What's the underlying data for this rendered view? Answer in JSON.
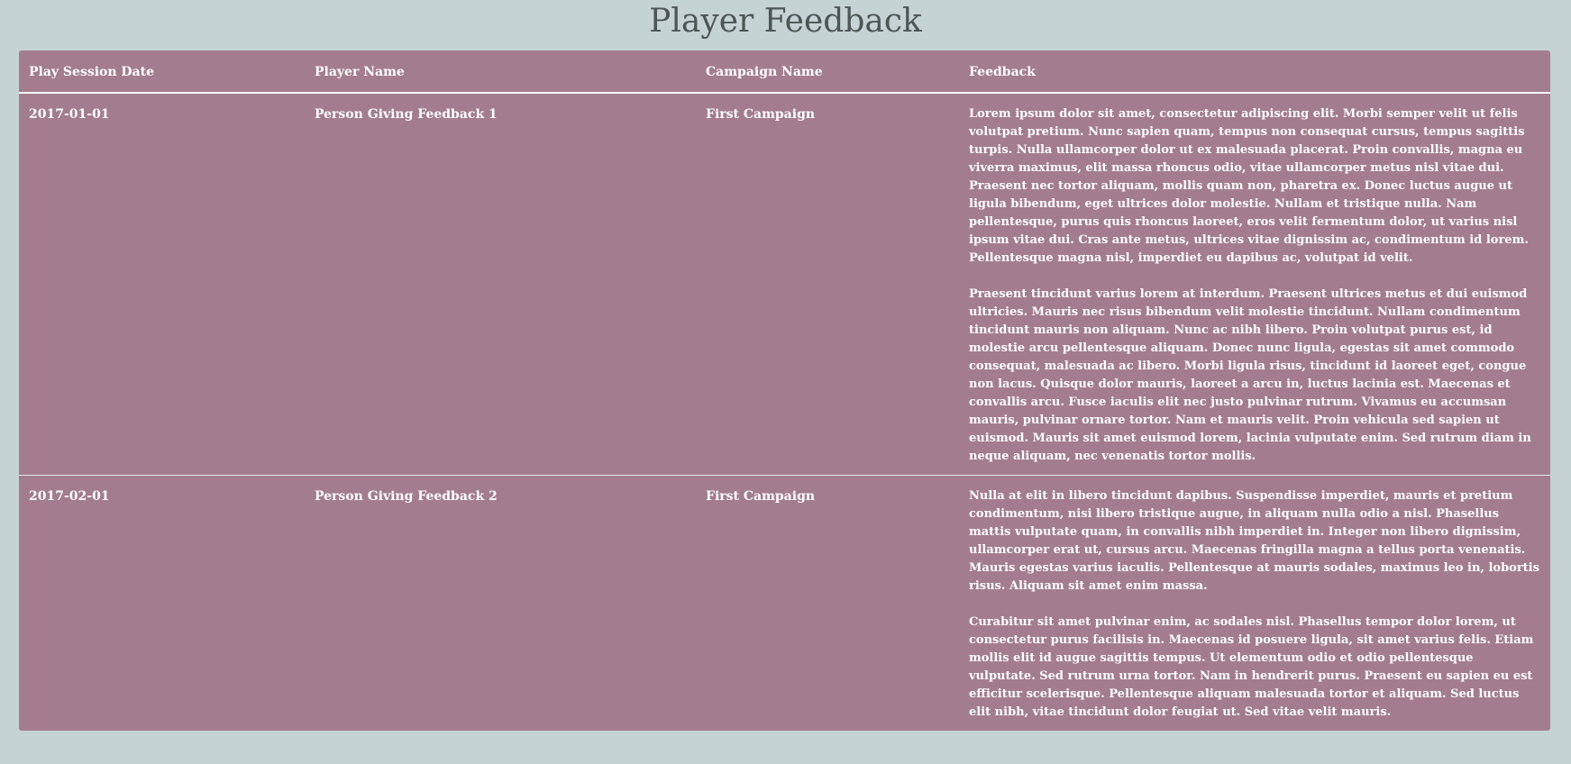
{
  "page": {
    "title": "Player Feedback"
  },
  "table": {
    "headers": [
      "Play Session Date",
      "Player Name",
      "Campaign Name",
      "Feedback"
    ],
    "rows": [
      {
        "date": "2017-01-01",
        "player": "Person Giving Feedback 1",
        "campaign": "First Campaign",
        "feedback": [
          "Lorem ipsum dolor sit amet, consectetur adipiscing elit. Morbi semper velit ut felis volutpat pretium. Nunc sapien quam, tempus non consequat cursus, tempus sagittis turpis. Nulla ullamcorper dolor ut ex malesuada placerat. Proin convallis, magna eu viverra maximus, elit massa rhoncus odio, vitae ullamcorper metus nisl vitae dui. Praesent nec tortor aliquam, mollis quam non, pharetra ex. Donec luctus augue ut ligula bibendum, eget ultrices dolor molestie. Nullam et tristique nulla. Nam pellentesque, purus quis rhoncus laoreet, eros velit fermentum dolor, ut varius nisl ipsum vitae dui. Cras ante metus, ultrices vitae dignissim ac, condimentum id lorem. Pellentesque magna nisl, imperdiet eu dapibus ac, volutpat id velit.",
          "Praesent tincidunt varius lorem at interdum. Praesent ultrices metus et dui euismod ultricies. Mauris nec risus bibendum velit molestie tincidunt. Nullam condimentum tincidunt mauris non aliquam. Nunc ac nibh libero. Proin volutpat purus est, id molestie arcu pellentesque aliquam. Donec nunc ligula, egestas sit amet commodo consequat, malesuada ac libero. Morbi ligula risus, tincidunt id laoreet eget, congue non lacus. Quisque dolor mauris, laoreet a arcu in, luctus lacinia est. Maecenas et convallis arcu. Fusce iaculis elit nec justo pulvinar rutrum. Vivamus eu accumsan mauris, pulvinar ornare tortor. Nam et mauris velit. Proin vehicula sed sapien ut euismod. Mauris sit amet euismod lorem, lacinia vulputate enim. Sed rutrum diam in neque aliquam, nec venenatis tortor mollis."
        ]
      },
      {
        "date": "2017-02-01",
        "player": "Person Giving Feedback 2",
        "campaign": "First Campaign",
        "feedback": [
          "Nulla at elit in libero tincidunt dapibus. Suspendisse imperdiet, mauris et pretium condimentum, nisi libero tristique augue, in aliquam nulla odio a nisl. Phasellus mattis vulputate quam, in convallis nibh imperdiet in. Integer non libero dignissim, ullamcorper erat ut, cursus arcu. Maecenas fringilla magna a tellus porta venenatis. Mauris egestas varius iaculis. Pellentesque at mauris sodales, maximus leo in, lobortis risus. Aliquam sit amet enim massa.",
          "Curabitur sit amet pulvinar enim, ac sodales nisl. Phasellus tempor dolor lorem, ut consectetur purus facilisis in. Maecenas id posuere ligula, sit amet varius felis. Etiam mollis elit id augue sagittis tempus. Ut elementum odio et odio pellentesque vulputate. Sed rutrum urna tortor. Nam in hendrerit purus. Praesent eu sapien eu est efficitur scelerisque. Pellentesque aliquam malesuada tortor et aliquam. Sed luctus elit nibh, vitae tincidunt dolor feugiat ut. Sed vitae velit mauris."
        ]
      }
    ]
  },
  "colors": {
    "background": "#c5d3d5",
    "table_background": "#a37d8d",
    "title_text": "#4d5654",
    "table_text": "#ffffff"
  }
}
